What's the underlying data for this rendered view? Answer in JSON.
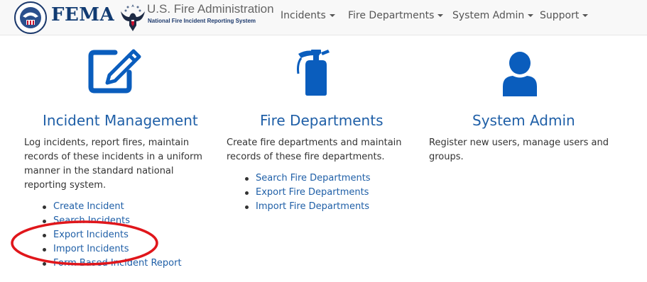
{
  "header": {
    "brand": "FEMA",
    "usfa_title": "U.S. Fire Administration",
    "usfa_subtitle": "National Fire Incident Reporting System",
    "seal_text": "U.S. DEPARTMENT OF HOMELAND SECURITY"
  },
  "nav": [
    {
      "label": "Incidents"
    },
    {
      "label": "Fire Departments"
    },
    {
      "label": "System Admin"
    },
    {
      "label": "Support"
    }
  ],
  "columns": [
    {
      "icon": "edit-icon",
      "title": "Incident Management",
      "description": "Log incidents, report fires, maintain records of these incidents in a uniform manner in the standard national reporting system.",
      "links": [
        "Create Incident",
        "Search Incidents",
        "Export Incidents",
        "Import Incidents",
        "Form Based Incident Report"
      ]
    },
    {
      "icon": "fire-extinguisher-icon",
      "title": "Fire Departments",
      "description": "Create fire departments and maintain records of these fire departments.",
      "links": [
        "Search Fire Departments",
        "Export Fire Departments",
        "Import Fire Departments"
      ]
    },
    {
      "icon": "user-icon",
      "title": "System Admin",
      "description": "Register new users, manage users and groups.",
      "links": []
    }
  ],
  "colors": {
    "link": "#1f5fa7",
    "icon": "#0a5dbd",
    "fema_navy": "#113b72",
    "annotation": "#e0161b"
  }
}
